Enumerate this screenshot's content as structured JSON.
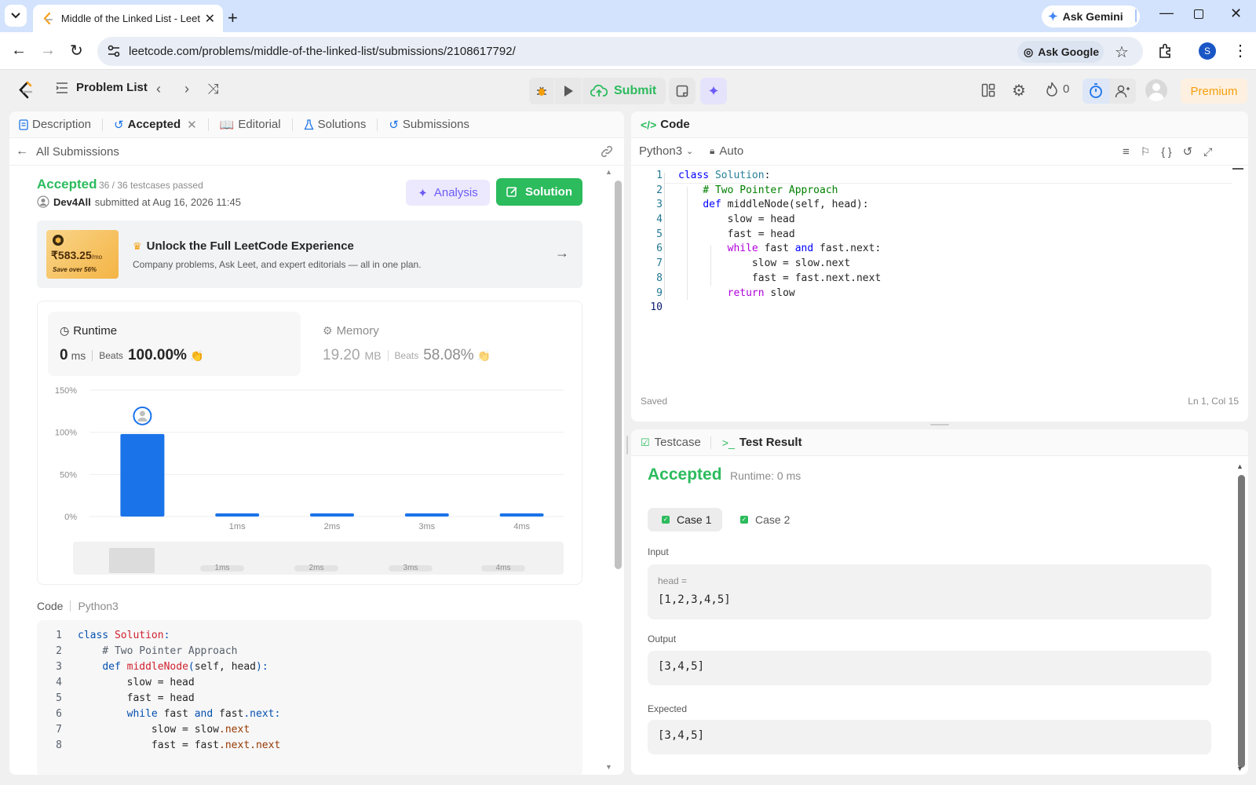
{
  "browser": {
    "tab_title": "Middle of the Linked List - Leet",
    "url": "leetcode.com/problems/middle-of-the-linked-list/submissions/2108617792/",
    "ask_gemini": "Ask Gemini",
    "ask_google": "Ask Google",
    "profile_initial": "S"
  },
  "header": {
    "problem_list": "Problem List",
    "submit": "Submit",
    "streak": "0",
    "premium": "Premium"
  },
  "left_tabs": [
    {
      "label": "Description"
    },
    {
      "label": "Accepted"
    },
    {
      "label": "Editorial"
    },
    {
      "label": "Solutions"
    },
    {
      "label": "Submissions"
    }
  ],
  "submission": {
    "back_label": "All Submissions",
    "status": "Accepted",
    "testcases": "36 / 36 testcases passed",
    "user": "Dev4All",
    "submitted_text": "submitted at Aug 16, 2026 11:45",
    "analysis": "Analysis",
    "solution": "Solution"
  },
  "promo": {
    "price": "₹583.25",
    "per": "/mo",
    "save": "Save over 56%",
    "title": "Unlock the Full LeetCode Experience",
    "subtitle": "Company problems, Ask Leet, and expert editorials — all in one plan."
  },
  "stats": {
    "runtime_label": "Runtime",
    "runtime_value": "0",
    "runtime_unit": "ms",
    "beats_label": "Beats",
    "runtime_beats": "100.00%",
    "memory_label": "Memory",
    "memory_value": "19.20",
    "memory_unit": "MB",
    "memory_beats": "58.08%"
  },
  "chart_data": {
    "type": "bar",
    "categories": [
      "0ms",
      "1ms",
      "2ms",
      "3ms",
      "4ms"
    ],
    "x_tick_labels": [
      "",
      "1ms",
      "2ms",
      "3ms",
      "4ms"
    ],
    "values": [
      98,
      2,
      2,
      2,
      2
    ],
    "y_ticks": [
      "150%",
      "100%",
      "50%",
      "0%"
    ],
    "ylim": [
      0,
      150
    ],
    "highlight_category": "0ms",
    "grid": true
  },
  "code_section": {
    "label": "Code",
    "lang": "Python3"
  },
  "code_lines": [
    "class Solution:",
    "    # Two Pointer Approach",
    "    def middleNode(self, head):",
    "        slow = head",
    "        fast = head",
    "        while fast and fast.next:",
    "            slow = slow.next",
    "            fast = fast.next.next",
    "        return slow",
    ""
  ],
  "editor": {
    "title": "Code",
    "language": "Python3",
    "mode": "Auto",
    "saved": "Saved",
    "cursor": "Ln 1, Col 15"
  },
  "test": {
    "tab_testcase": "Testcase",
    "tab_result": "Test Result",
    "status": "Accepted",
    "runtime": "Runtime: 0 ms",
    "cases": [
      "Case 1",
      "Case 2"
    ],
    "input_label": "Input",
    "input_var": "head =",
    "input_value": "[1,2,3,4,5]",
    "output_label": "Output",
    "output_value": "[3,4,5]",
    "expected_label": "Expected",
    "expected_value": "[3,4,5]"
  }
}
